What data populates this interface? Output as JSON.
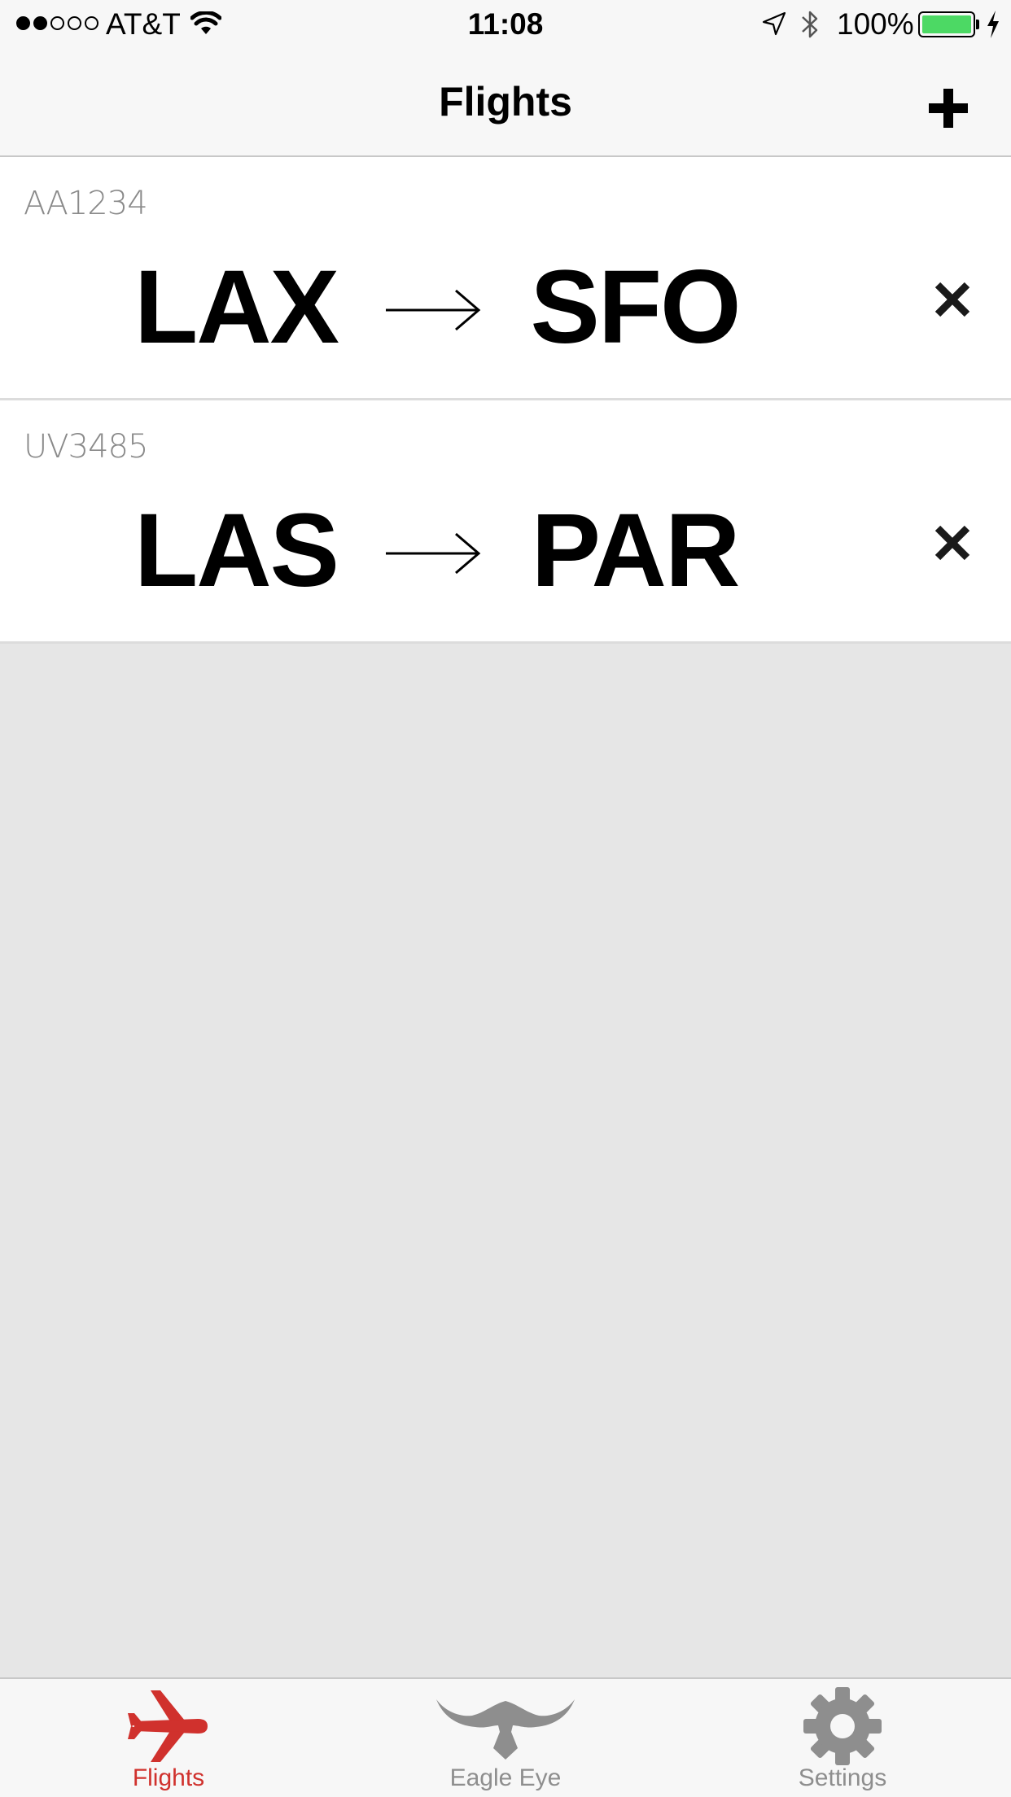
{
  "status_bar": {
    "carrier": "AT&T",
    "time": "11:08",
    "battery_percent": "100%",
    "signal_bars_filled": 2,
    "signal_bars_total": 5,
    "battery_level": 1.0,
    "battery_color": "#4cd964"
  },
  "nav": {
    "title": "Flights",
    "add_icon": "plus-icon"
  },
  "flights": [
    {
      "flight_number": "AA1234",
      "origin": "LAX",
      "destination": "SFO"
    },
    {
      "flight_number": "UV3485",
      "origin": "LAS",
      "destination": "PAR"
    }
  ],
  "tabs": [
    {
      "label": "Flights",
      "icon": "airplane-icon",
      "active": true
    },
    {
      "label": "Eagle Eye",
      "icon": "eagle-icon",
      "active": false
    },
    {
      "label": "Settings",
      "icon": "gear-icon",
      "active": false
    }
  ],
  "colors": {
    "accent": "#d0312d",
    "tab_inactive": "#8e8e8e",
    "background": "#e6e6e6"
  }
}
